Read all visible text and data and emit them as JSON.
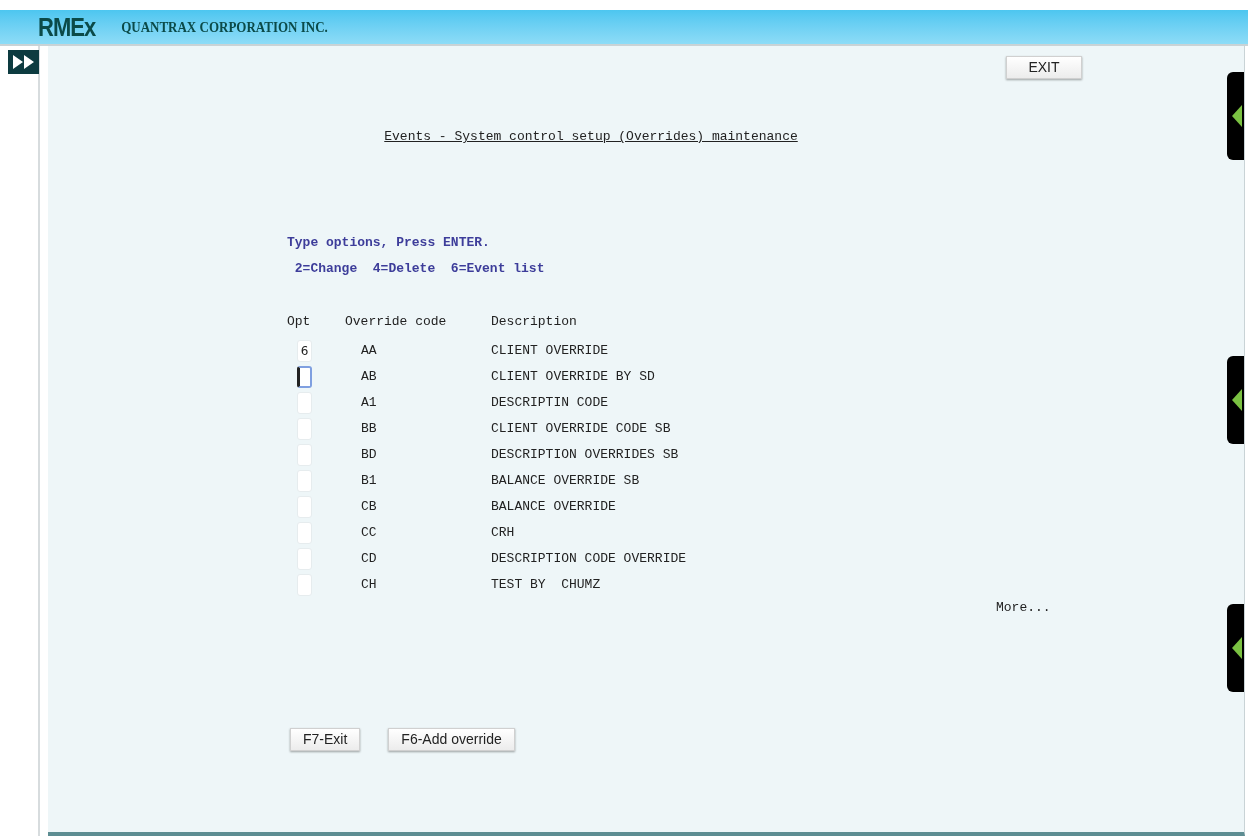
{
  "header": {
    "logo": "RMEx",
    "company": "QUANTRAX CORPORATION INC."
  },
  "exit_button": "EXIT",
  "title": "Events - System control setup (Overrides) maintenance",
  "instructions": "Type options, Press ENTER.",
  "options": " 2=Change  4=Delete  6=Event list",
  "columns": [
    "Opt",
    "Override code",
    "Description"
  ],
  "rows": [
    {
      "opt": "6",
      "code": "AA",
      "description": "CLIENT OVERRIDE",
      "focused": false
    },
    {
      "code": "AB",
      "description": "CLIENT OVERRIDE BY SD",
      "focused": true
    },
    {
      "code": "A1",
      "description": "DESCRIPTIN CODE",
      "focused": false
    },
    {
      "code": "BB",
      "description": "CLIENT OVERRIDE CODE SB",
      "focused": false
    },
    {
      "code": "BD",
      "description": "DESCRIPTION OVERRIDES SB",
      "focused": false
    },
    {
      "code": "B1",
      "description": "BALANCE OVERRIDE SB",
      "focused": false
    },
    {
      "code": "CB",
      "description": "BALANCE OVERRIDE",
      "focused": false
    },
    {
      "code": "CC",
      "description": "CRH",
      "focused": false
    },
    {
      "code": "CD",
      "description": "DESCRIPTION CODE OVERRIDE",
      "focused": false
    },
    {
      "code": "CH",
      "description": "TEST BY  CHUMZ",
      "focused": false
    }
  ],
  "more": "More...",
  "buttons": [
    "F7-Exit",
    "F6-Add override"
  ]
}
